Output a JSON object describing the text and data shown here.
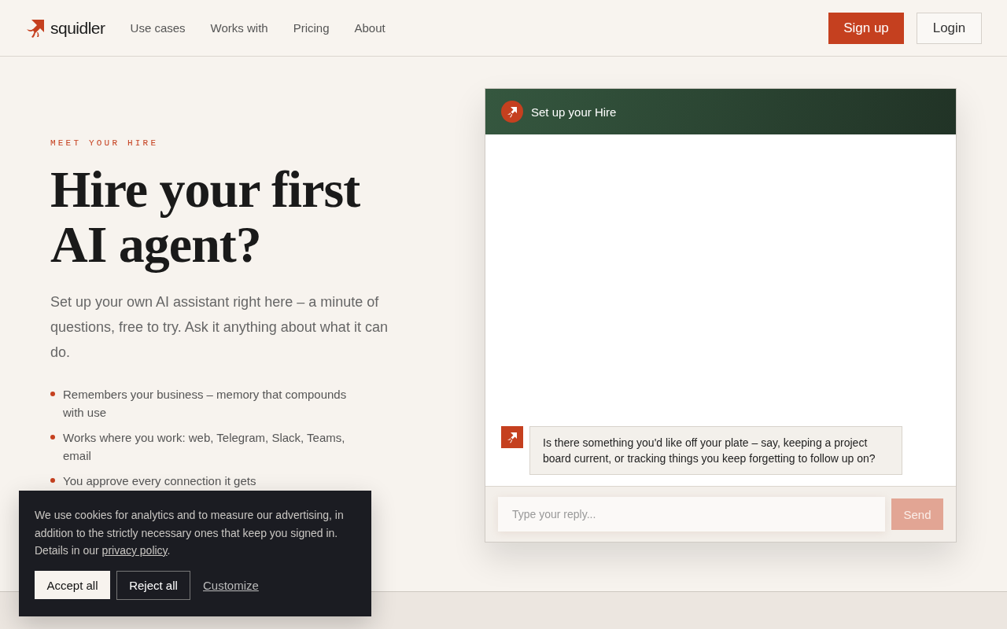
{
  "header": {
    "brand": "squidler",
    "nav": [
      {
        "label": "Use cases"
      },
      {
        "label": "Works with"
      },
      {
        "label": "Pricing"
      },
      {
        "label": "About"
      }
    ],
    "signup": "Sign up",
    "login": "Login"
  },
  "hero": {
    "eyebrow": "MEET YOUR HIRE",
    "title_lines": [
      "Hire your first",
      "AI agent?"
    ],
    "intro": "Set up your own AI assistant right here – a minute of questions, free to try. Ask it anything about what it can do.",
    "bullets": [
      "Remembers your business – memory that compounds with use",
      "Works where you work: web, Telegram, Slack, Teams, email",
      "You approve every connection it gets"
    ]
  },
  "chat": {
    "title": "Set up your Hire",
    "messages": [
      {
        "text": "Is there something you'd like off your plate – say, keeping a project board current, or tracking things you keep forgetting to follow up on?"
      }
    ],
    "input": {
      "placeholder": "Type your reply..."
    },
    "send": {
      "label": "Send",
      "disabled": true
    }
  },
  "cookie_banner": {
    "text": "We use cookies for analytics and to measure our advertising, in addition to the strictly necessary ones that keep you signed in. Details in our ",
    "link": "privacy policy",
    "text_end": ".",
    "accept": "Accept all",
    "reject": "Reject all",
    "customize": "Customize"
  }
}
